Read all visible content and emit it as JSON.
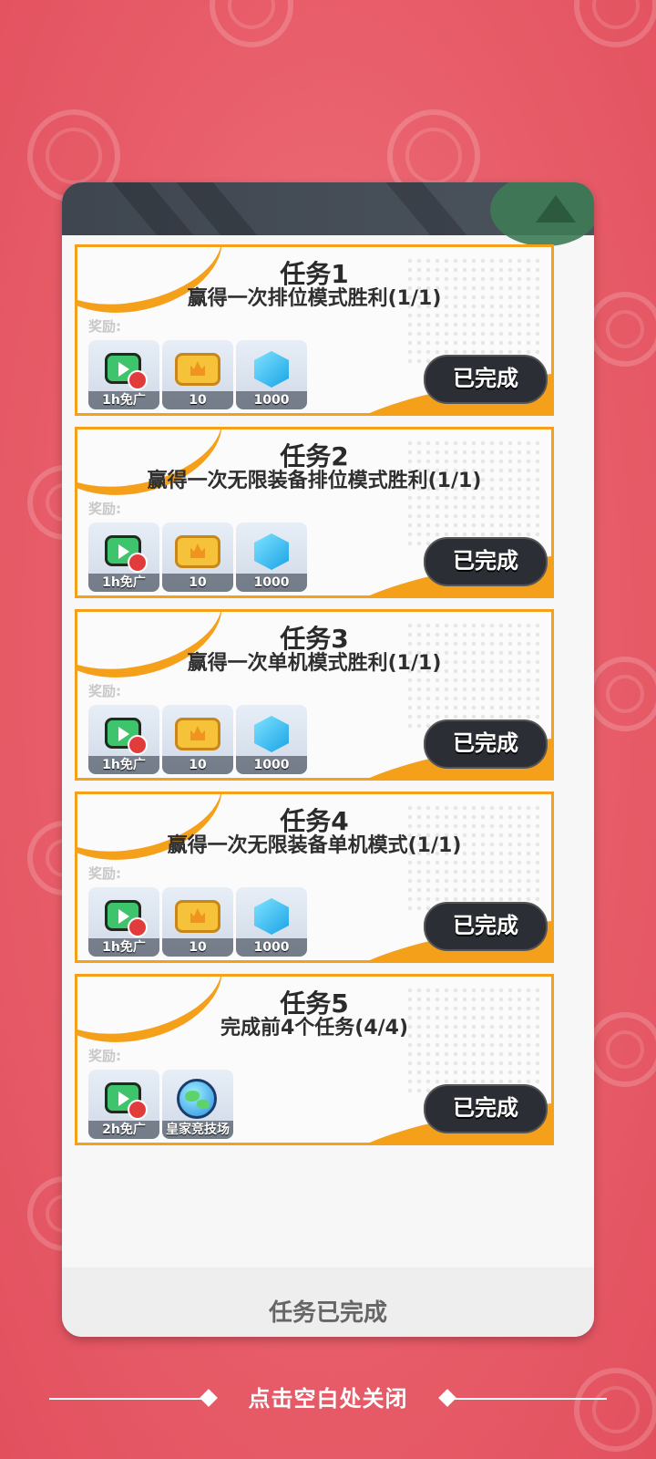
{
  "panel": {
    "reward_label": "奖励:",
    "footer_status": "任务已完成"
  },
  "tasks": [
    {
      "title": "任务1",
      "description": "赢得一次排位模式胜利(1/1)",
      "rewards": [
        {
          "icon": "ad-free-tv-icon",
          "amount": "1h免广"
        },
        {
          "icon": "gold-ticket-icon",
          "amount": "10"
        },
        {
          "icon": "blue-gem-icon",
          "amount": "1000"
        }
      ],
      "button": "已完成"
    },
    {
      "title": "任务2",
      "description": "赢得一次无限装备排位模式胜利(1/1)",
      "rewards": [
        {
          "icon": "ad-free-tv-icon",
          "amount": "1h免广"
        },
        {
          "icon": "gold-ticket-icon",
          "amount": "10"
        },
        {
          "icon": "blue-gem-icon",
          "amount": "1000"
        }
      ],
      "button": "已完成"
    },
    {
      "title": "任务3",
      "description": "赢得一次单机模式胜利(1/1)",
      "rewards": [
        {
          "icon": "ad-free-tv-icon",
          "amount": "1h免广"
        },
        {
          "icon": "gold-ticket-icon",
          "amount": "10"
        },
        {
          "icon": "blue-gem-icon",
          "amount": "1000"
        }
      ],
      "button": "已完成"
    },
    {
      "title": "任务4",
      "description": "赢得一次无限装备单机模式(1/1)",
      "rewards": [
        {
          "icon": "ad-free-tv-icon",
          "amount": "1h免广"
        },
        {
          "icon": "gold-ticket-icon",
          "amount": "10"
        },
        {
          "icon": "blue-gem-icon",
          "amount": "1000"
        }
      ],
      "button": "已完成"
    },
    {
      "title": "任务5",
      "description": "完成前4个任务(4/4)",
      "rewards": [
        {
          "icon": "ad-free-tv-icon",
          "amount": "2h免广"
        },
        {
          "icon": "globe-arena-icon",
          "amount": "皇家竞技场"
        }
      ],
      "button": "已完成"
    }
  ],
  "close_hint": "点击空白处关闭"
}
